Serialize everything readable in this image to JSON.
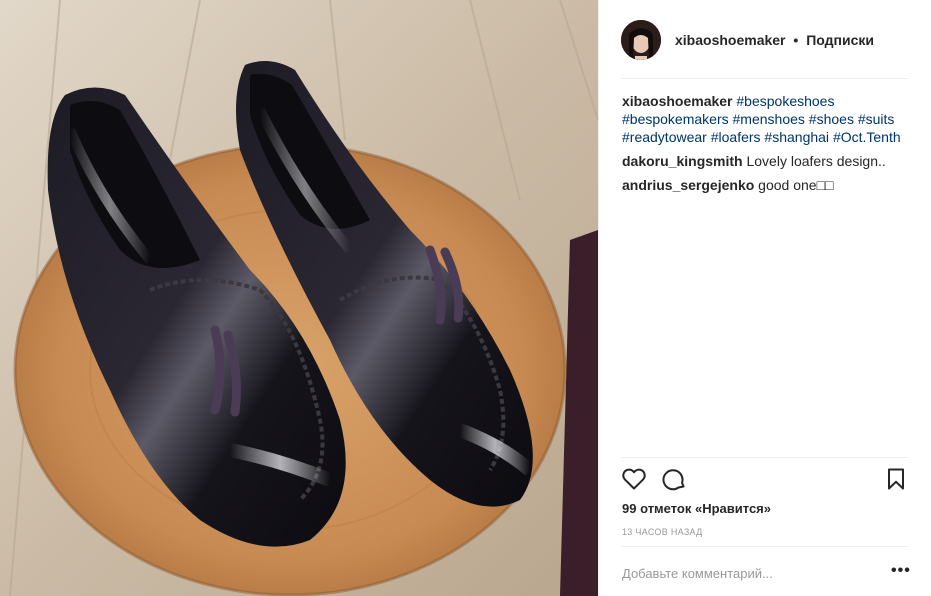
{
  "post": {
    "image_alt": "Black leather tassel loafers on a wooden stool",
    "author": {
      "username": "xibaoshoemaker",
      "separator": "•",
      "follow_label": "Подписки"
    },
    "caption": {
      "username": "xibaoshoemaker",
      "lines": [
        [
          "#bespokeshoes"
        ],
        [
          "#bespokemakers",
          "#menshoes",
          "#shoes",
          "#suits"
        ],
        [
          "#readytowear",
          "#loafers",
          "#shanghai",
          "#Oct.Tenth"
        ]
      ]
    },
    "comments": [
      {
        "username": "dakoru_kingsmith",
        "text": "Lovely loafers design.."
      },
      {
        "username": "andrius_sergejenko",
        "text": "good one□□"
      }
    ],
    "likes_text": "99 отметок «Нравится»",
    "timestamp": "13 часов назад",
    "add_comment_placeholder": "Добавьте комментарий...",
    "more_label": "•••",
    "icons": {
      "like": "heart-icon",
      "comment": "comment-bubble-icon",
      "save": "bookmark-icon",
      "more": "more-options-icon"
    },
    "colors": {
      "hashtag": "#003569",
      "text": "#262626",
      "muted": "#999999",
      "divider": "#efefef"
    }
  }
}
